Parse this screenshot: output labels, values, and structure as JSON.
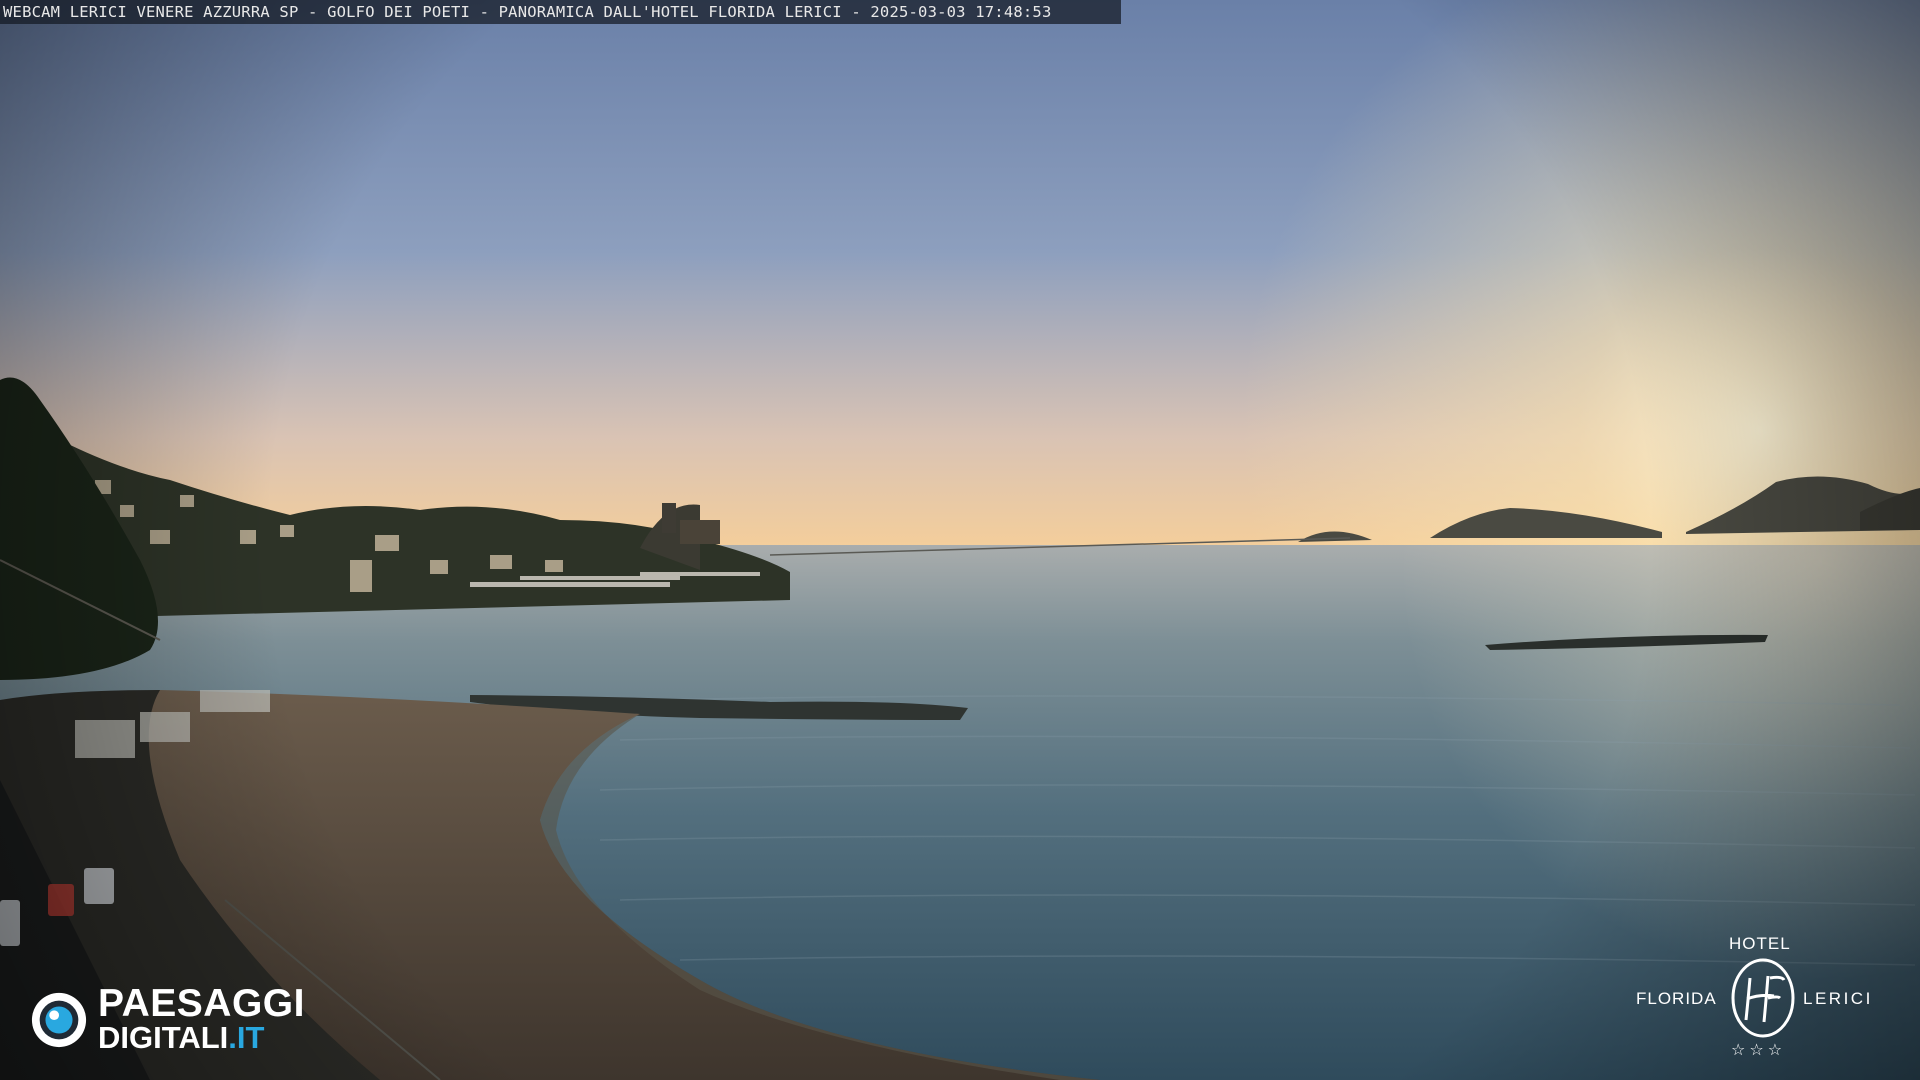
{
  "caption": "WEBCAM LERICI VENERE AZZURRA SP - GOLFO DEI POETI - PANORAMICA DALL'HOTEL FLORIDA LERICI - 2025-03-03 17:48:53",
  "logo_left": {
    "icon": "eye-icon",
    "line1": "PAESAGGI",
    "line2_main": "DIGITALI",
    "line2_tld": ".IT",
    "accent": "#29a8e0"
  },
  "logo_right": {
    "top": "HOTEL",
    "left": "FLORIDA",
    "right": "LERICI",
    "monogram": "HF",
    "stars": "☆☆☆"
  },
  "colors": {
    "sky_top": "#6f86ad",
    "sky_horizon": "#f6d59e",
    "sea": "#5e7a88",
    "land": "#1d2b1f"
  }
}
